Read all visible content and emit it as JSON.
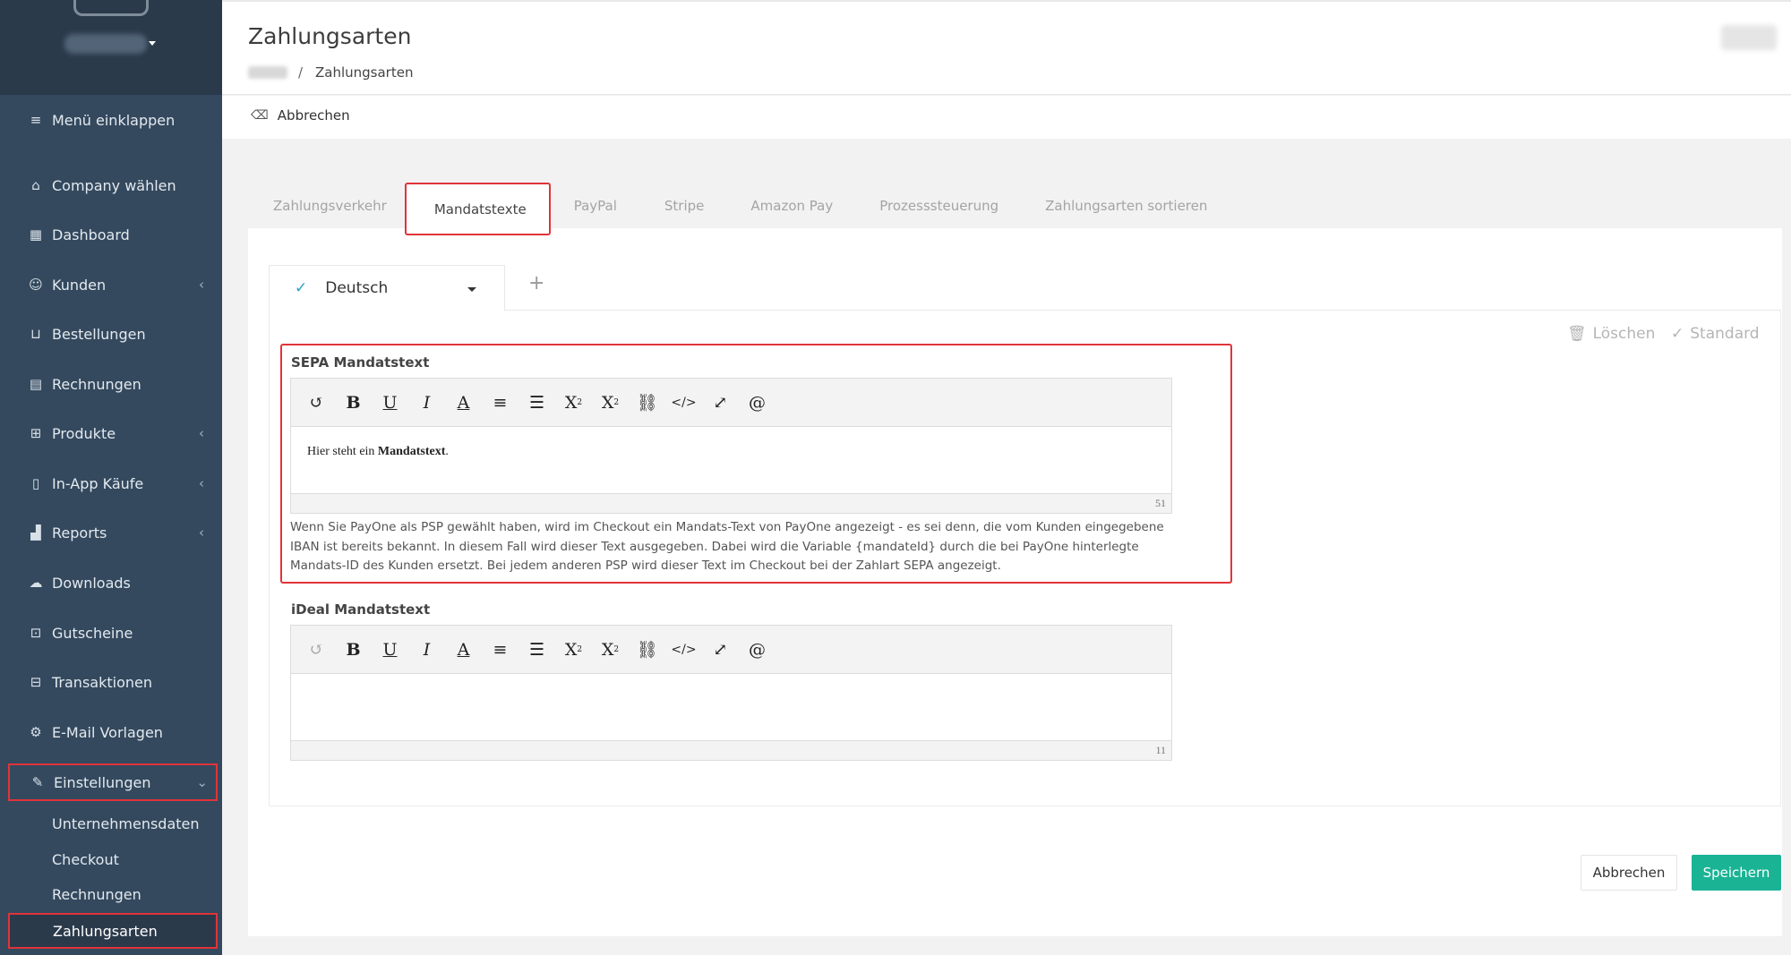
{
  "sidebar": {
    "collapse_label": "Menü einklappen",
    "items": [
      {
        "label": "Company wählen",
        "icon": "home-icon"
      },
      {
        "label": "Dashboard",
        "icon": "grid-icon"
      },
      {
        "label": "Kunden",
        "icon": "user-icon"
      },
      {
        "label": "Bestellungen",
        "icon": "basket-icon"
      },
      {
        "label": "Rechnungen",
        "icon": "invoice-icon"
      },
      {
        "label": "Produkte",
        "icon": "gift-icon"
      },
      {
        "label": "In-App Käufe",
        "icon": "phone-icon"
      },
      {
        "label": "Reports",
        "icon": "chart-icon"
      },
      {
        "label": "Downloads",
        "icon": "cloud-download-icon"
      },
      {
        "label": "Gutscheine",
        "icon": "voucher-icon"
      },
      {
        "label": "Transaktionen",
        "icon": "transaction-icon"
      },
      {
        "label": "E-Mail Vorlagen",
        "icon": "gears-icon"
      },
      {
        "label": "Einstellungen",
        "icon": "wrench-icon"
      }
    ],
    "sub_items": [
      "Unternehmensdaten",
      "Checkout",
      "Rechnungen",
      "Zahlungsarten"
    ]
  },
  "header": {
    "title": "Zahlungsarten",
    "breadcrumb_separator": "/",
    "breadcrumb_current": "Zahlungsarten"
  },
  "actionbar": {
    "cancel_label": "Abbrechen"
  },
  "tabs": [
    "Zahlungsverkehr",
    "Mandatstexte",
    "PayPal",
    "Stripe",
    "Amazon Pay",
    "Prozesssteuerung",
    "Zahlungsarten sortieren"
  ],
  "active_tab": "Mandatstexte",
  "language": {
    "selected": "Deutsch",
    "add_symbol": "+"
  },
  "right_actions": {
    "delete_label": "Löschen",
    "default_label": "Standard"
  },
  "sepa": {
    "label": "SEPA Mandatstext",
    "content_prefix": "Hier steht ein ",
    "content_bold": "Mandatstext",
    "content_suffix": ".",
    "char_count": "51",
    "help_text": "Wenn Sie PayOne als PSP gewählt haben, wird im Checkout ein Mandats-Text von PayOne angezeigt - es sei denn, die vom Kunden eingegebene IBAN ist bereits bekannt. In diesem Fall wird dieser Text ausgegeben. Dabei wird die Variable {mandateId} durch die bei PayOne hinterlegte Mandats-ID des Kunden ersetzt. Bei jedem anderen PSP wird dieser Text im Checkout bei der Zahlart SEPA angezeigt."
  },
  "ideal": {
    "label": "iDeal Mandatstext",
    "char_count": "11"
  },
  "footer": {
    "cancel_label": "Abbrechen",
    "save_label": "Speichern"
  },
  "colors": {
    "sidebar_bg": "#34495e",
    "highlight_border": "#e0343a",
    "primary_button": "#1ab394",
    "check_color": "#2aa2c8"
  }
}
